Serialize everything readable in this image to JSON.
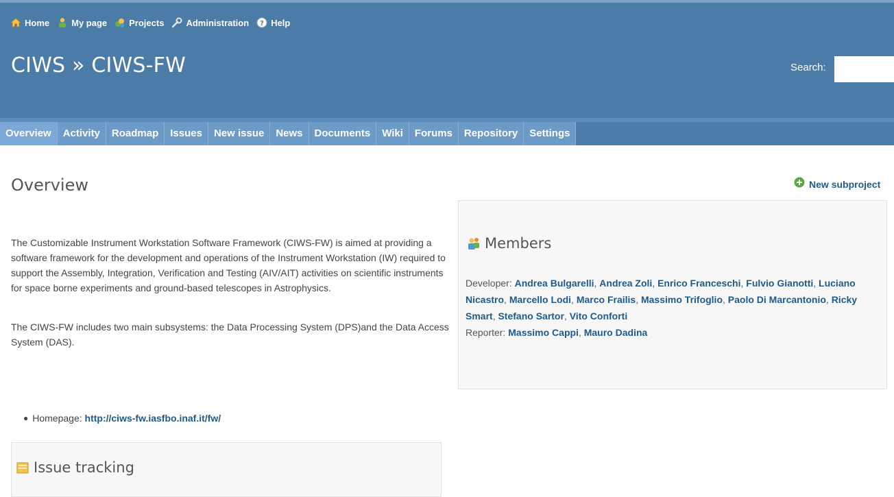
{
  "top_menu": {
    "items": [
      {
        "label": "Home",
        "icon": "home-icon"
      },
      {
        "label": "My page",
        "icon": "user-icon"
      },
      {
        "label": "Projects",
        "icon": "projects-icon"
      },
      {
        "label": "Administration",
        "icon": "wrench-icon"
      },
      {
        "label": "Help",
        "icon": "help-icon"
      }
    ]
  },
  "header": {
    "title": "CIWS » CIWS-FW",
    "search_label": "Search:"
  },
  "tabs": [
    {
      "label": "Overview",
      "selected": true
    },
    {
      "label": "Activity"
    },
    {
      "label": "Roadmap"
    },
    {
      "label": "Issues"
    },
    {
      "label": "New issue"
    },
    {
      "label": "News"
    },
    {
      "label": "Documents"
    },
    {
      "label": "Wiki"
    },
    {
      "label": "Forums"
    },
    {
      "label": "Repository"
    },
    {
      "label": "Settings"
    }
  ],
  "content": {
    "title": "Overview",
    "new_subproject": "New subproject",
    "description_1": "The Customizable Instrument Workstation Software Framework (CIWS-FW) is aimed at providing a software framework for the development and operations of the Instrument Workstation (IW) required to support the Assembly, Integration, Verification and Testing (AIV/AIT) activities on scientific instruments for space borne experiments and ground-based telescopes in Astrophysics.",
    "description_2": "The CIWS-FW includes two main subsystems: the Data Processing System (DPS)and the Data Access System (DAS).",
    "homepage_label": "Homepage:",
    "homepage_url": "http://ciws-fw.iasfbo.inaf.it/fw/"
  },
  "members": {
    "title": "Members",
    "developer_label": "Developer:",
    "developers": [
      "Andrea Bulgarelli",
      "Andrea Zoli",
      "Enrico Franceschi",
      "Fulvio Gianotti",
      "Luciano Nicastro",
      "Marcello Lodi",
      "Marco Frailis",
      "Massimo Trifoglio",
      "Paolo Di Marcantonio",
      "Ricky Smart",
      "Stefano Sartor",
      "Vito Conforti"
    ],
    "reporter_label": "Reporter:",
    "reporters": [
      "Massimo Cappi",
      "Mauro Dadina"
    ]
  },
  "issue_tracking": {
    "title": "Issue tracking"
  },
  "colors": {
    "header_bg": "#4b7ba7",
    "tab_bg": "#6d9bc8",
    "link": "#1e5a8c"
  }
}
